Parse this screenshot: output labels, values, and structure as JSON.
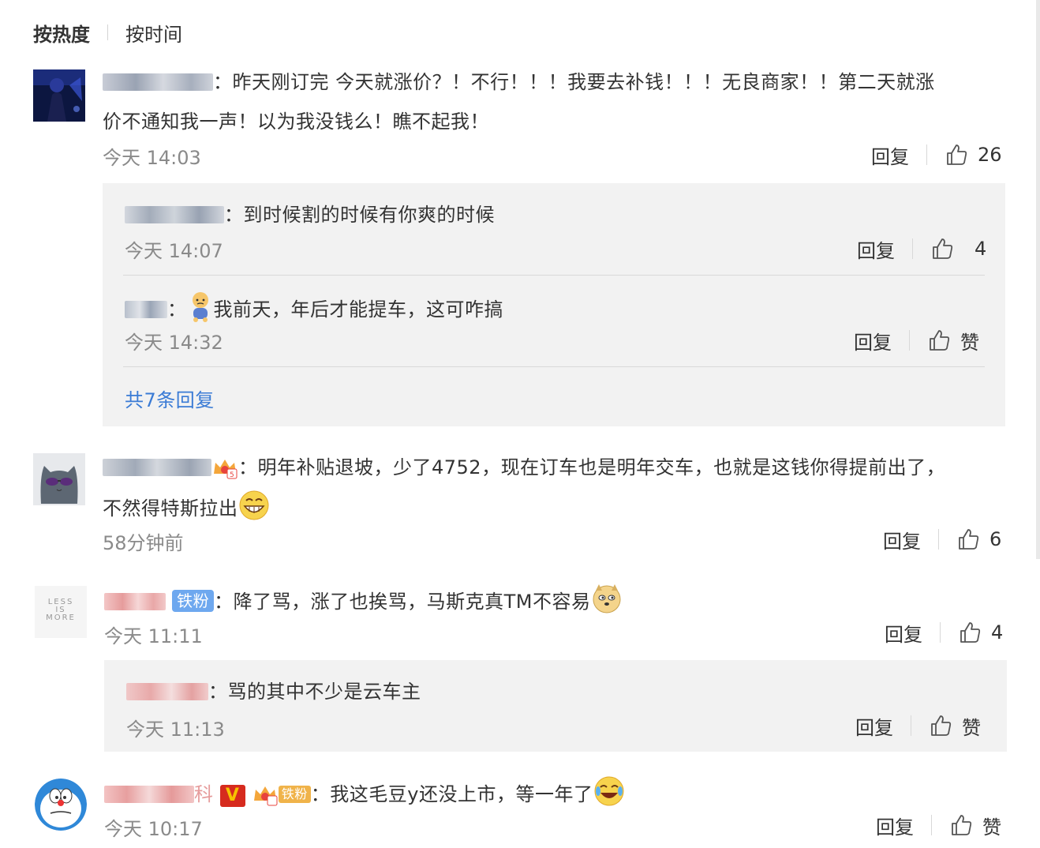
{
  "sort": {
    "hot": "按热度",
    "time": "按时间"
  },
  "common": {
    "reply": "回复",
    "like_zan": "赞"
  },
  "comments": [
    {
      "text_line1": "：昨天刚订完 今天就涨价？！不行！！！我要去补钱！！！无良商家！！第二天就涨",
      "text_line2": "价不通知我一声！以为我没钱么！瞧不起我！",
      "time": "今天 14:03",
      "likes": "26",
      "replies": [
        {
          "text": "：到时候割的时候有你爽的时候",
          "time": "今天 14:07",
          "likes": "4"
        },
        {
          "text": "我前天，年后才能提车，这可咋搞",
          "time": "今天 14:32",
          "likes": "赞"
        }
      ],
      "more_replies": "共7条回复"
    },
    {
      "text_line1": "：明年补贴退坡，少了4752，现在订车也是明年交车，也就是这钱你得提前出了，",
      "text_line2": "不然得特斯拉出",
      "time": "58分钟前",
      "likes": "6"
    },
    {
      "fan_badge": "铁粉",
      "text_line1": "：降了骂，涨了也挨骂，马斯克真TM不容易",
      "time": "今天 11:11",
      "likes": "4",
      "avatar_text": [
        "LESS",
        "IS",
        "MORE"
      ],
      "replies": [
        {
          "text": "：骂的其中不少是云车主",
          "time": "今天 11:13",
          "likes": "赞"
        }
      ]
    },
    {
      "v_badge": "V",
      "fan_badge": "铁粉",
      "name_suffix": "科",
      "text_line1": "：我这毛豆y还没上市，等一年了",
      "time": "今天 10:17",
      "likes": "赞"
    }
  ]
}
